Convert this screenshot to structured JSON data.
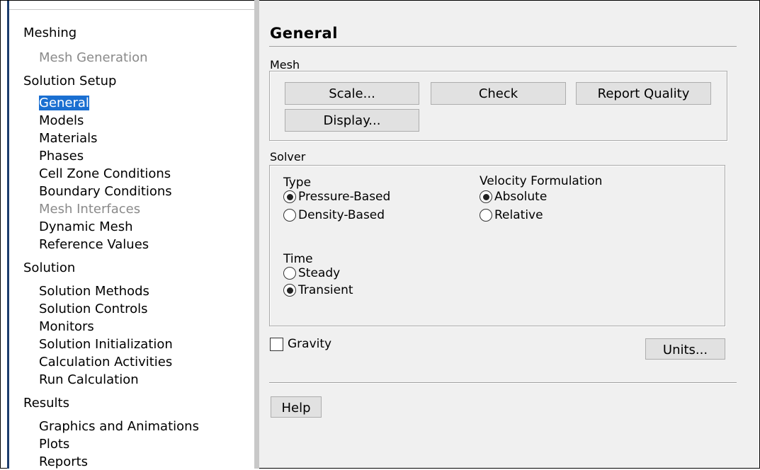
{
  "tree": {
    "items": [
      {
        "label": "Meshing",
        "kind": "section",
        "state": "normal"
      },
      {
        "label": "Mesh Generation",
        "kind": "child",
        "state": "disabled"
      },
      {
        "label": "Solution Setup",
        "kind": "section",
        "state": "normal"
      },
      {
        "label": "General",
        "kind": "child",
        "state": "selected"
      },
      {
        "label": "Models",
        "kind": "child",
        "state": "normal"
      },
      {
        "label": "Materials",
        "kind": "child",
        "state": "normal"
      },
      {
        "label": "Phases",
        "kind": "child",
        "state": "normal"
      },
      {
        "label": "Cell Zone Conditions",
        "kind": "child",
        "state": "normal"
      },
      {
        "label": "Boundary Conditions",
        "kind": "child",
        "state": "normal"
      },
      {
        "label": "Mesh Interfaces",
        "kind": "child",
        "state": "disabled"
      },
      {
        "label": "Dynamic Mesh",
        "kind": "child",
        "state": "normal"
      },
      {
        "label": "Reference Values",
        "kind": "child",
        "state": "normal"
      },
      {
        "label": "Solution",
        "kind": "section",
        "state": "normal"
      },
      {
        "label": "Solution Methods",
        "kind": "child",
        "state": "normal"
      },
      {
        "label": "Solution Controls",
        "kind": "child",
        "state": "normal"
      },
      {
        "label": "Monitors",
        "kind": "child",
        "state": "normal"
      },
      {
        "label": "Solution Initialization",
        "kind": "child",
        "state": "normal"
      },
      {
        "label": "Calculation Activities",
        "kind": "child",
        "state": "normal"
      },
      {
        "label": "Run Calculation",
        "kind": "child",
        "state": "normal"
      },
      {
        "label": "Results",
        "kind": "section",
        "state": "normal"
      },
      {
        "label": "Graphics and Animations",
        "kind": "child",
        "state": "normal"
      },
      {
        "label": "Plots",
        "kind": "child",
        "state": "normal"
      },
      {
        "label": "Reports",
        "kind": "child",
        "state": "normal"
      }
    ]
  },
  "panel": {
    "title": "General",
    "mesh": {
      "label": "Mesh",
      "scale_button": "Scale...",
      "check_button": "Check",
      "report_quality_button": "Report Quality",
      "display_button": "Display..."
    },
    "solver": {
      "label": "Solver",
      "type_label": "Type",
      "type_options": [
        {
          "label": "Pressure-Based",
          "selected": true
        },
        {
          "label": "Density-Based",
          "selected": false
        }
      ],
      "velocity_label": "Velocity Formulation",
      "velocity_options": [
        {
          "label": "Absolute",
          "selected": true
        },
        {
          "label": "Relative",
          "selected": false
        }
      ],
      "time_label": "Time",
      "time_options": [
        {
          "label": "Steady",
          "selected": false
        },
        {
          "label": "Transient",
          "selected": true
        }
      ]
    },
    "gravity_label": "Gravity",
    "gravity_checked": false,
    "units_button": "Units...",
    "help_button": "Help"
  },
  "colors": {
    "selection": "#1a6fd1",
    "panel_background": "#f0f0f0",
    "button_background": "#e1e1e1"
  }
}
